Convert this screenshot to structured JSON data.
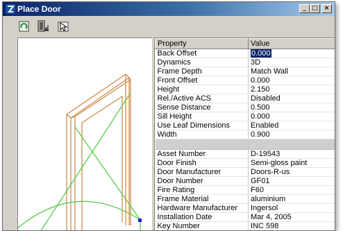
{
  "window": {
    "title": "Place Door",
    "caption_buttons": {
      "minimize": "_",
      "maximize": "□",
      "close": "×"
    }
  },
  "toolbar": {
    "buttons": [
      {
        "name": "Refresh",
        "icon": "refresh-icon"
      },
      {
        "name": "Door",
        "icon": "door-icon"
      },
      {
        "name": "Pointer",
        "icon": "pointer-icon"
      }
    ]
  },
  "properties": {
    "headers": [
      "Property",
      "Value"
    ],
    "group1": [
      {
        "name": "Back Offset",
        "value": "0.000",
        "selected": true
      },
      {
        "name": "Dynamics",
        "value": "3D"
      },
      {
        "name": "Frame Depth",
        "value": "Match Wall"
      },
      {
        "name": "Front Offset",
        "value": "0.000"
      },
      {
        "name": "Height",
        "value": "2.150"
      },
      {
        "name": "Rel./Active ACS",
        "value": "Disabled"
      },
      {
        "name": "Sense Distance",
        "value": "0.500"
      },
      {
        "name": "Sill Height",
        "value": "0.000"
      },
      {
        "name": "Use Leaf Dimensions",
        "value": "Enabled"
      },
      {
        "name": "Width",
        "value": "0.900"
      }
    ],
    "group2": [
      {
        "name": "Asset Number",
        "value": "D-19543"
      },
      {
        "name": "Door Finish",
        "value": "Semi-gloss paint"
      },
      {
        "name": "Door Manufacturer",
        "value": "Doors-R-us"
      },
      {
        "name": "Door Number",
        "value": "GF01"
      },
      {
        "name": "Fire Rating",
        "value": "F60"
      },
      {
        "name": "Frame Material",
        "value": "aluminium"
      },
      {
        "name": "Hardware Manufacturer",
        "value": "Ingersol"
      },
      {
        "name": "Installation Date",
        "value": "Mar 4, 2005"
      },
      {
        "name": "Key Number",
        "value": "INC 598"
      }
    ]
  },
  "colors": {
    "titlebar_start": "#0a246a",
    "titlebar_end": "#a6caf0",
    "frame": "#cd8c4a",
    "swing": "#55c94a"
  }
}
